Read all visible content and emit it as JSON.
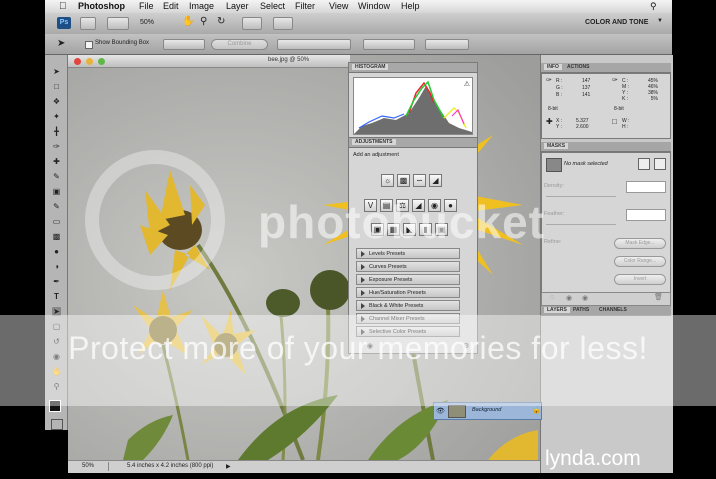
{
  "menubar": {
    "app": "Photoshop",
    "items": [
      "File",
      "Edit",
      "Image",
      "Layer",
      "Select",
      "Filter",
      "View",
      "Window",
      "Help"
    ]
  },
  "appbar": {
    "zoom": "50%",
    "workspace": "COLOR AND TONE"
  },
  "options": {
    "show_bounding_box": "Show Bounding Box",
    "combine": "Combine"
  },
  "document": {
    "title": "bee.jpg @ 50%",
    "zoom": "50%",
    "size": "5.4 inches x 4.2 inches (800 ppi)"
  },
  "panels": {
    "histogram_tab": "HISTOGRAM",
    "adjustments_tab": "ADJUSTMENTS",
    "add_adjustment": "Add an adjustment",
    "presets": [
      "Levels Presets",
      "Curves Presets",
      "Exposure Presets",
      "Hue/Saturation Presets",
      "Black & White Presets",
      "Channel Mixer Presets",
      "Selective Color Presets"
    ],
    "info_tab": "INFO",
    "actions_tab": "ACTIONS",
    "info_values": {
      "r": "R :",
      "g": "G :",
      "b": "B :",
      "rv": "147",
      "gv": "137",
      "bv": "141",
      "c": "C :",
      "mm": "M :",
      "yy": "Y :",
      "k": "K :",
      "cv": "45%",
      "mv": "46%",
      "yv": "38%",
      "kv": "5%",
      "bits1": "8-bit",
      "bits2": "8-bit",
      "x": "X :",
      "y": "Y :",
      "xv": "5.327",
      "yv2": "2.600",
      "w": "W :",
      "h": "H :"
    },
    "masks_tab": "MASKS",
    "no_mask": "No mask selected",
    "density": "Density:",
    "feather": "Feather:",
    "refine": "Refine:",
    "mask_edge": "Mask Edge...",
    "color_range": "Color Range...",
    "invert": "Invert",
    "layers_tab": "LAYERS",
    "paths_tab": "PATHS",
    "channels_tab": "CHANNELS",
    "background_layer": "Background"
  },
  "watermark": {
    "logo": "photobucket",
    "line": "Protect more of your memories for less!"
  },
  "brand": "lynda.com",
  "colors": {
    "ps_blue": "#1d4f86",
    "histogram_gray": "#6e6e6e",
    "flower_yellow": "#f0c020"
  }
}
